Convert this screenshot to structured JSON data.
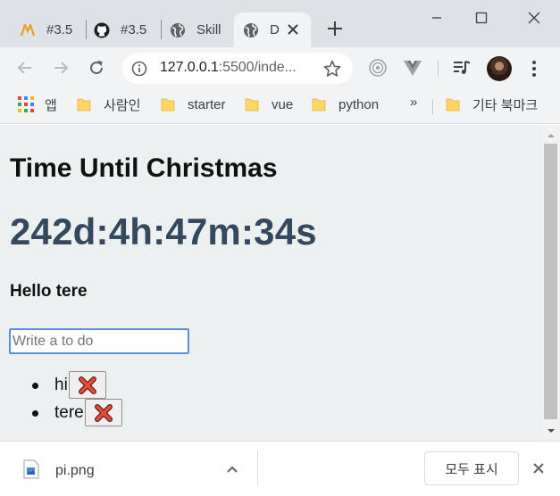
{
  "tabs": [
    {
      "label": "#3.5",
      "icon": "mooc-logo-icon"
    },
    {
      "label": "#3.5",
      "icon": "github-icon"
    },
    {
      "label": "Skill",
      "icon": "globe-icon"
    },
    {
      "label": "D",
      "icon": "globe-icon",
      "active": true
    }
  ],
  "toolbar": {
    "url_host": "127.0.0.1",
    "url_rest": ":5500/inde..."
  },
  "bookmarks": {
    "apps_label": "앱",
    "items": [
      "사람인",
      "starter",
      "vue",
      "python"
    ],
    "more": "»",
    "other": "기타 북마크"
  },
  "page": {
    "title": "Time Until Christmas",
    "clock": "242d:4h:47m:34s",
    "greeting": "Hello tere",
    "input_placeholder": "Write a to do",
    "todos": [
      "hi",
      "tere"
    ]
  },
  "downloads": {
    "file_name": "pi.png",
    "show_all": "모두 표시"
  },
  "colors": {
    "page_bg": "#ecf0f1",
    "clock": "#34495e",
    "delete_icon": "#e74c3c",
    "input_focus": "#5b8fd6"
  }
}
